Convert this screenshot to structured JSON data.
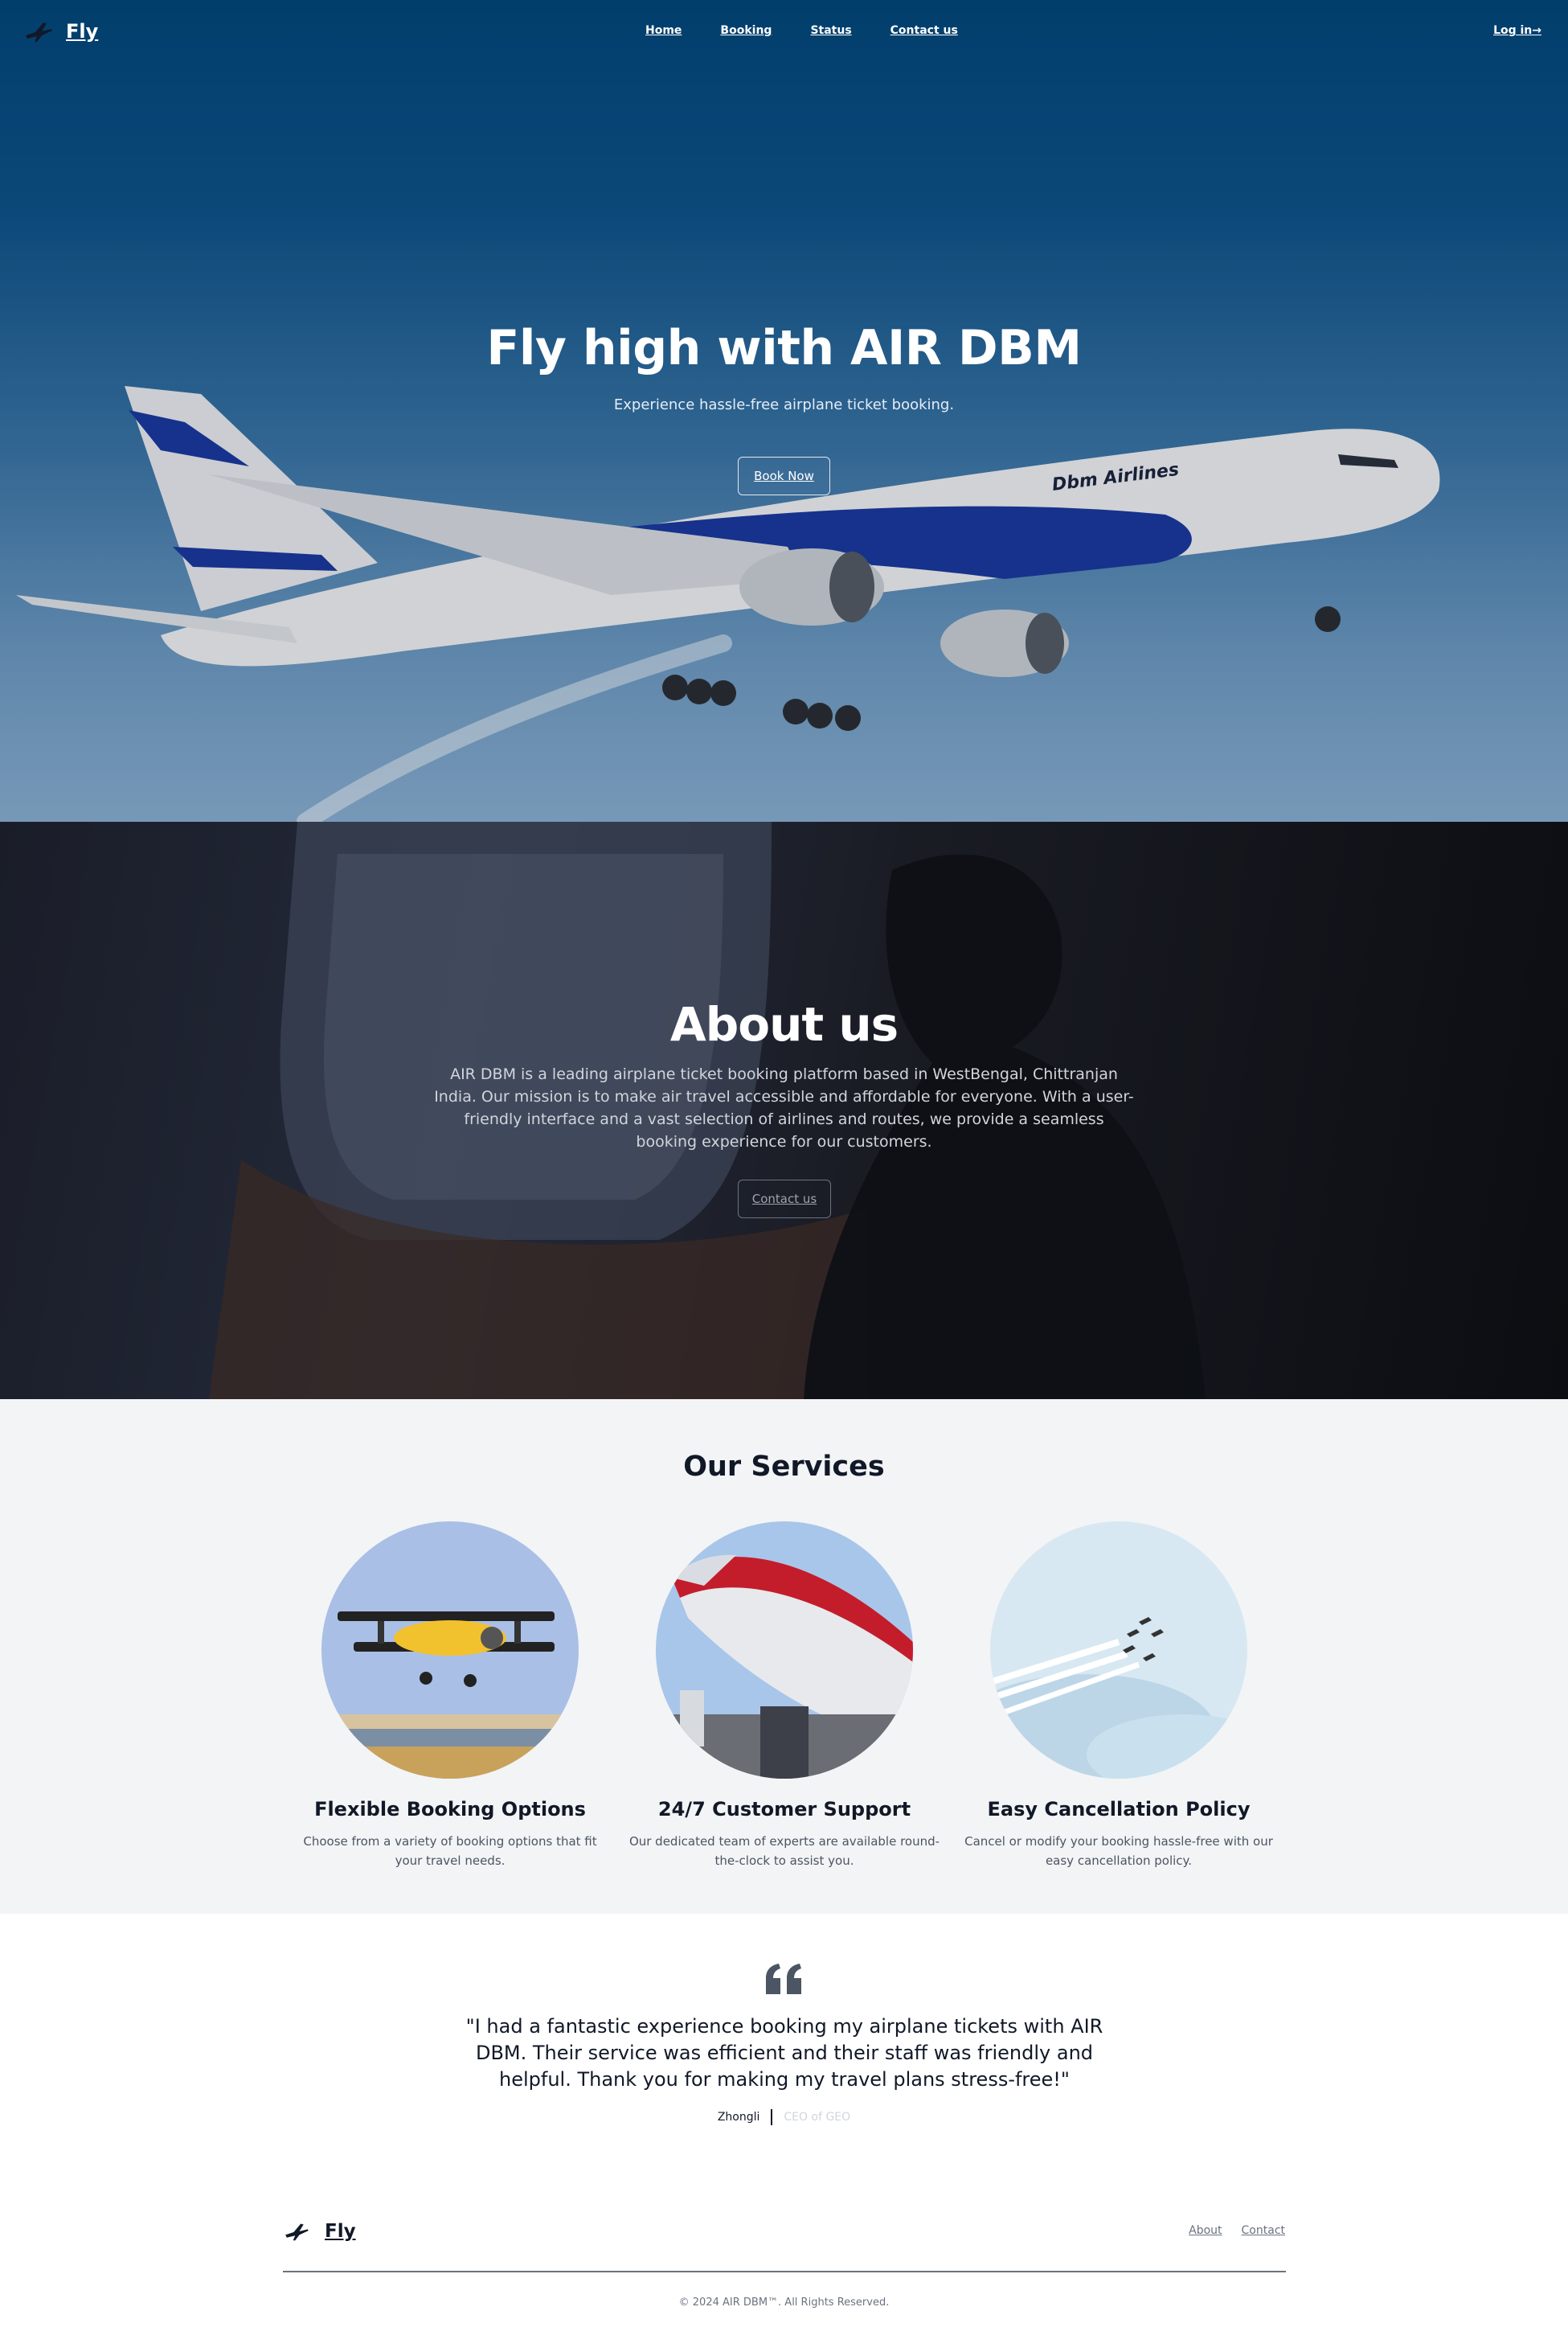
{
  "nav": {
    "brand": "Fly",
    "brand_icon": "airplane-icon",
    "links": [
      "Home",
      "Booking",
      "Status",
      "Contact us"
    ],
    "login": "Log in→"
  },
  "hero": {
    "title": "Fly high with AIR DBM",
    "subtitle": "Experience hassle-free airplane ticket booking.",
    "button": "Book Now",
    "plane_livery": "Dbm Airlines"
  },
  "about": {
    "title": "About us",
    "text": "AIR DBM is a leading airplane ticket booking platform based in WestBengal, Chittranjan India. Our mission is to make air travel accessible and affordable for everyone. With a user-friendly interface and a vast selection of airlines and routes, we provide a seamless booking experience for our customers.",
    "button": "Contact us"
  },
  "services": {
    "title": "Our Services",
    "items": [
      {
        "title": "Flexible Booking Options",
        "desc": "Choose from a variety of booking options that fit your travel needs."
      },
      {
        "title": "24/7 Customer Support",
        "desc": "Our dedicated team of experts are available round-the-clock to assist you."
      },
      {
        "title": "Easy Cancellation Policy",
        "desc": "Cancel or modify your booking hassle-free with our easy cancellation policy."
      }
    ]
  },
  "testimonial": {
    "quote_icon": "quote-icon",
    "quote": "\"I had a fantastic experience booking my airplane tickets with AIR DBM. Their service was efficient and their staff was friendly and helpful. Thank you for making my travel plans stress-free!\"",
    "name": "Zhongli",
    "role": "CEO of GEO"
  },
  "footer": {
    "brand": "Fly",
    "links": [
      "About",
      "Contact"
    ],
    "copyright": "© 2024 AIR DBM™. All Rights Reserved."
  },
  "colors": {
    "hero_sky": "#0d5289",
    "services_bg": "#f3f4f6",
    "text_dark": "#111827",
    "text_muted": "#6b7280"
  }
}
